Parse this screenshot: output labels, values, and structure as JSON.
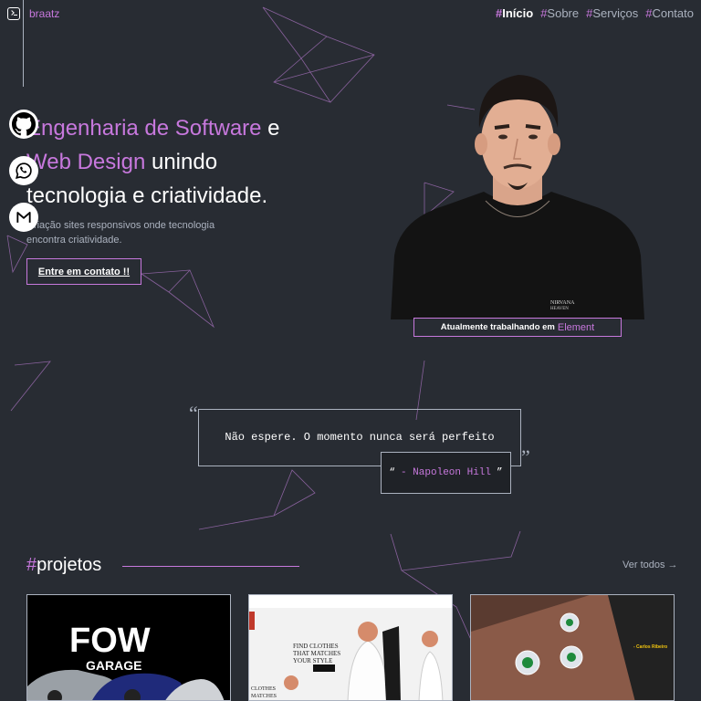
{
  "brand": {
    "name": "braatz"
  },
  "nav": {
    "items": [
      {
        "hash": "#",
        "label": "Início",
        "active": true
      },
      {
        "hash": "#",
        "label": "Sobre"
      },
      {
        "hash": "#",
        "label": "Serviços"
      },
      {
        "hash": "#",
        "label": "Contato"
      }
    ]
  },
  "social": [
    "github-icon",
    "whatsapp-icon",
    "gmail-icon"
  ],
  "hero": {
    "title_1_accent": "Engenharia de Software",
    "title_1_rest": " e",
    "title_2_accent": "Web Design",
    "title_2_rest": " unindo",
    "title_3": "tecnologia e criatividade.",
    "subtitle": "Criação sites responsivos onde tecnologia encontra criatividade.",
    "cta_label": "Entre em contato !!"
  },
  "status": {
    "prefix": "Atualmente trabalhando em",
    "company": "Element"
  },
  "quote": {
    "text": "Não espere. O momento nunca será perfeito",
    "open_mark": "“",
    "close_mark": "”",
    "author_open": "“",
    "author": "- Napoleon Hill",
    "author_close": "”"
  },
  "projects": {
    "hash": "#",
    "title": "projetos",
    "see_all": "Ver todos →",
    "cards": [
      {
        "logo_text": "FOW",
        "logo_sub": "GARAGE"
      },
      {
        "headline": "FIND CLOTHES THAT MATCHES YOUR STYLE",
        "button": "Shop Now",
        "side_text": "CLOTHES THAT MATCHES"
      },
      {
        "quote_author": "- Carlos Ribeiro"
      }
    ]
  },
  "colors": {
    "background": "#282c33",
    "accent": "#c778dd",
    "muted": "#abb2bf"
  }
}
